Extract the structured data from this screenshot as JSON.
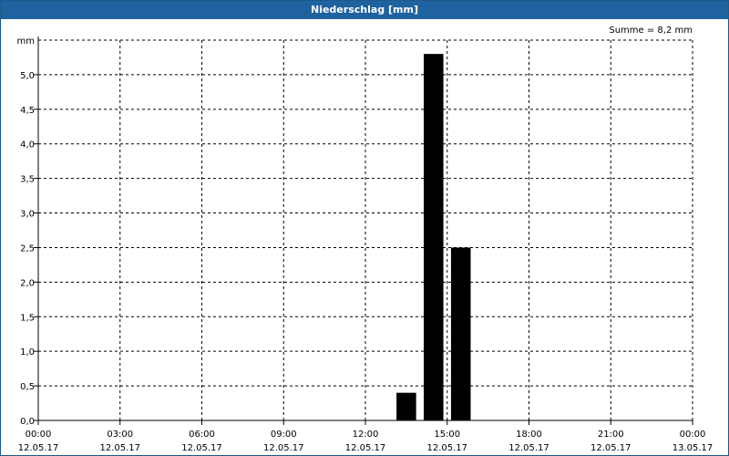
{
  "window": {
    "title": "Niederschlag [mm]"
  },
  "colors": {
    "title_bar": "#1f62a0",
    "bar": "#000000",
    "grid": "#000000"
  },
  "chart_data": {
    "type": "bar",
    "title": "Niederschlag [mm]",
    "ylabel": "mm",
    "annotation": "Summe = 8,2 mm",
    "ylim": [
      0,
      5.5
    ],
    "yticks": [
      "0,0",
      "0,5",
      "1,0",
      "1,5",
      "2,0",
      "2,5",
      "3,0",
      "3,5",
      "4,0",
      "4,5",
      "5,0"
    ],
    "ytick_values": [
      0,
      0.5,
      1.0,
      1.5,
      2.0,
      2.5,
      3.0,
      3.5,
      4.0,
      4.5,
      5.0
    ],
    "xlim_hours": [
      0,
      24
    ],
    "xticks": [
      {
        "hour": 0,
        "time": "00:00",
        "date": "12.05.17"
      },
      {
        "hour": 3,
        "time": "03:00",
        "date": "12.05.17"
      },
      {
        "hour": 6,
        "time": "06:00",
        "date": "12.05.17"
      },
      {
        "hour": 9,
        "time": "09:00",
        "date": "12.05.17"
      },
      {
        "hour": 12,
        "time": "12:00",
        "date": "12.05.17"
      },
      {
        "hour": 15,
        "time": "15:00",
        "date": "12.05.17"
      },
      {
        "hour": 18,
        "time": "18:00",
        "date": "12.05.17"
      },
      {
        "hour": 21,
        "time": "21:00",
        "date": "12.05.17"
      },
      {
        "hour": 24,
        "time": "00:00",
        "date": "13.05.17"
      }
    ],
    "bars": [
      {
        "hour": 13,
        "value": 0.4
      },
      {
        "hour": 14,
        "value": 5.3
      },
      {
        "hour": 15,
        "value": 2.5
      }
    ],
    "grid": true
  }
}
